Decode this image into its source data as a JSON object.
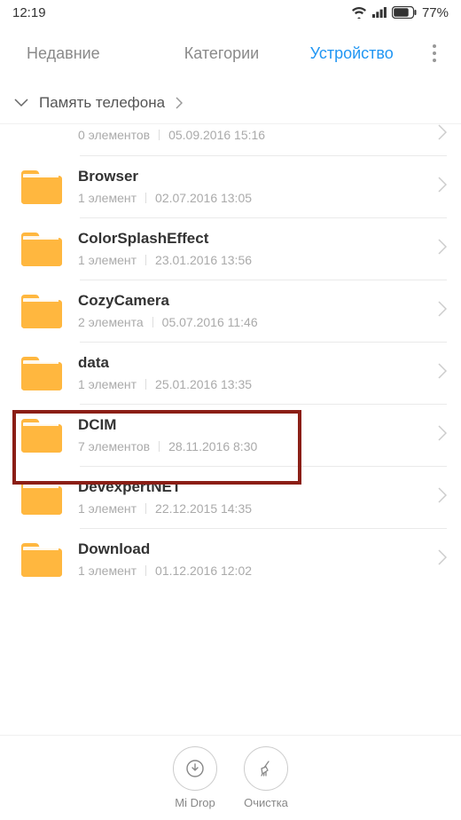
{
  "status": {
    "time": "12:19",
    "battery": "77%"
  },
  "tabs": {
    "recent": "Недавние",
    "categories": "Категории",
    "device": "Устройство"
  },
  "breadcrumb": {
    "label": "Память телефона"
  },
  "folders": {
    "partial": {
      "count": "0 элементов",
      "date": "05.09.2016 15:16"
    },
    "browser": {
      "name": "Browser",
      "count": "1 элемент",
      "date": "02.07.2016 13:05"
    },
    "colorsplash": {
      "name": "ColorSplashEffect",
      "count": "1 элемент",
      "date": "23.01.2016 13:56"
    },
    "cozycamera": {
      "name": "CozyCamera",
      "count": "2 элемента",
      "date": "05.07.2016 11:46"
    },
    "data": {
      "name": "data",
      "count": "1 элемент",
      "date": "25.01.2016 13:35"
    },
    "dcim": {
      "name": "DCIM",
      "count": "7 элементов",
      "date": "28.11.2016 8:30"
    },
    "devexpert": {
      "name": "DevexpertNET",
      "count": "1 элемент",
      "date": "22.12.2015 14:35"
    },
    "download": {
      "name": "Download",
      "count": "1 элемент",
      "date": "01.12.2016 12:02"
    }
  },
  "bottom": {
    "midrop": "Mi Drop",
    "cleanup": "Очистка"
  }
}
